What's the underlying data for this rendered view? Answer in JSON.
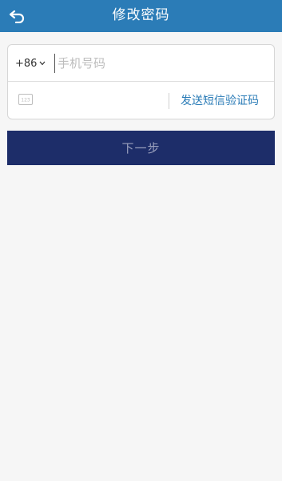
{
  "header": {
    "title": "修改密码",
    "back_icon": "back-arrow-icon",
    "background": "#2b7cb7"
  },
  "form": {
    "country_code": "+86",
    "phone_placeholder": "手机号码",
    "code_icon": "sms-code-icon",
    "send_code_label": "发送短信验证码",
    "accent": "#2b7cb7"
  },
  "actions": {
    "next_label": "下一步",
    "next_background": "#1d2d69"
  }
}
